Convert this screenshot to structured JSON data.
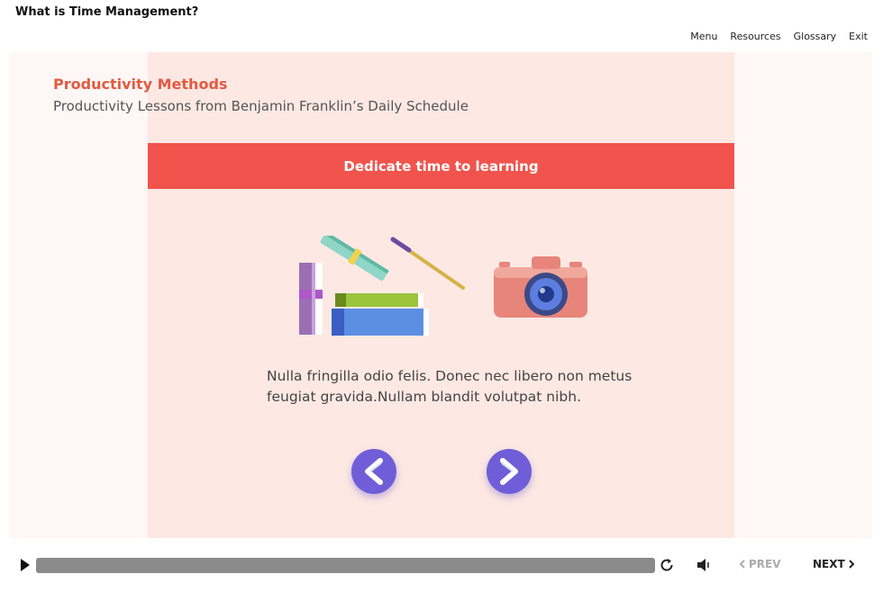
{
  "header": {
    "course_title": "What is Time Management?",
    "nav": [
      "Menu",
      "Resources",
      "Glossary",
      "Exit"
    ]
  },
  "slide": {
    "heading": "Productivity Methods",
    "subheading": "Productivity Lessons from Benjamin Franklin’s Daily Schedule",
    "banner": "Dedicate time to learning",
    "body": "Nulla fringilla odio felis. Donec nec libero non metus feugiat gravida.Nullam blandit volutpat nibh.",
    "illustrations": [
      "books-paintbrush-illustration",
      "camera-illustration"
    ]
  },
  "player": {
    "prev_label": "PREV",
    "next_label": "NEXT",
    "prev_enabled": false
  },
  "colors": {
    "accent": "#e35a42",
    "banner": "#f0544d",
    "panel": "#fde8e3",
    "nav_button": "#6f5ed8"
  }
}
